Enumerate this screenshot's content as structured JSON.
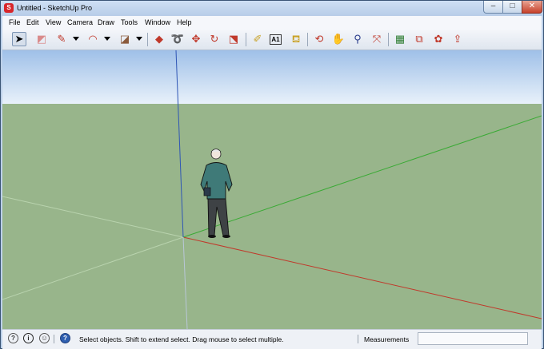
{
  "window": {
    "title": "Untitled - SketchUp Pro",
    "app_icon": "sketchup-icon"
  },
  "window_controls": {
    "minimize": "–",
    "maximize": "□",
    "close": "✕"
  },
  "menu": [
    "File",
    "Edit",
    "View",
    "Camera",
    "Draw",
    "Tools",
    "Window",
    "Help"
  ],
  "toolbar": {
    "tools": [
      {
        "name": "select-icon",
        "glyph": "➤",
        "color": "#000000"
      },
      {
        "name": "eraser-icon",
        "glyph": "◩",
        "color": "#d98a8a"
      },
      {
        "name": "pencil-icon",
        "glyph": "✎",
        "color": "#c0392b"
      },
      {
        "name": "arc-icon",
        "glyph": "◠",
        "color": "#c0392b"
      },
      {
        "name": "rectangle-icon",
        "glyph": "◪",
        "color": "#8a5a3c"
      },
      {
        "name": "push-pull-icon",
        "glyph": "◆",
        "color": "#c0392b"
      },
      {
        "name": "follow-me-icon",
        "glyph": "➰",
        "color": "#c0392b"
      },
      {
        "name": "move-icon",
        "glyph": "✥",
        "color": "#c0392b"
      },
      {
        "name": "rotate-icon",
        "glyph": "↻",
        "color": "#c0392b"
      },
      {
        "name": "scale-icon",
        "glyph": "⬔",
        "color": "#c0392b"
      },
      {
        "name": "tape-measure-icon",
        "glyph": "✐",
        "color": "#c9a227"
      },
      {
        "name": "text-icon",
        "glyph": "A1",
        "color": "#000000"
      },
      {
        "name": "paint-bucket-icon",
        "glyph": "⛾",
        "color": "#c9a227"
      },
      {
        "name": "orbit-icon",
        "glyph": "⟲",
        "color": "#c0392b"
      },
      {
        "name": "pan-icon",
        "glyph": "✋",
        "color": "#333333"
      },
      {
        "name": "zoom-icon",
        "glyph": "⚲",
        "color": "#2c3e8c"
      },
      {
        "name": "zoom-extents-icon",
        "glyph": "⤧",
        "color": "#c0392b"
      },
      {
        "name": "3d-warehouse-icon",
        "glyph": "▦",
        "color": "#2e7d32"
      },
      {
        "name": "components-icon",
        "glyph": "⧉",
        "color": "#c0392b"
      },
      {
        "name": "extension-warehouse-icon",
        "glyph": "✿",
        "color": "#c0392b"
      },
      {
        "name": "share-model-icon",
        "glyph": "⇪",
        "color": "#c0392b"
      }
    ]
  },
  "status": {
    "icons": [
      "geo-location-icon",
      "credits-icon",
      "user-icon",
      "help-icon"
    ],
    "message": "Select objects. Shift to extend select. Drag mouse to select multiple.",
    "measurements_label": "Measurements",
    "measurements_value": ""
  },
  "colors": {
    "sky_top": "#9fc0e8",
    "sky_bottom": "#e8f1fa",
    "ground": "#98b58b",
    "axis_red": "#c0392b",
    "axis_green": "#3aaa35",
    "axis_blue": "#2e55b5"
  }
}
